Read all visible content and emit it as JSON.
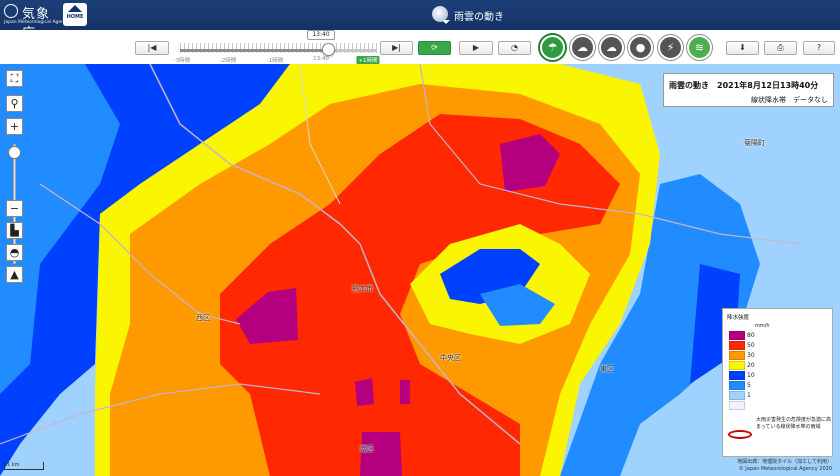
{
  "header": {
    "agency_name_jp": "気象庁",
    "agency_name_en": "Japan Meteorological Agency",
    "home_label": "HOME",
    "page_title": "雨雲の動き"
  },
  "timeline": {
    "current_time": "13:40",
    "ticks": [
      "-3時間",
      "-2時間",
      "-1時間",
      "13:40",
      "+1時間"
    ],
    "position_fraction": 0.75
  },
  "toolbar": {
    "left_buttons": [
      "step-back",
      "step-forward",
      "refresh",
      "play",
      "speed"
    ],
    "mode_buttons": [
      "rain-cloud-active",
      "thunder-cloud",
      "cloud-rain",
      "rain-drop",
      "lightning",
      "linear-rain-band"
    ],
    "right_buttons": [
      "download",
      "print",
      "help"
    ]
  },
  "info_box": {
    "title": "雨雲の動き　2021年8月12日13時40分",
    "subtitle": "線状降水帯　データなし"
  },
  "legend": {
    "title": "降水強度",
    "unit": "mm/h",
    "levels": [
      {
        "label": "80",
        "color": "#b4007e"
      },
      {
        "label": "50",
        "color": "#ff2800"
      },
      {
        "label": "30",
        "color": "#ff9900"
      },
      {
        "label": "20",
        "color": "#faf500"
      },
      {
        "label": "10",
        "color": "#0041ff"
      },
      {
        "label": "5",
        "color": "#218cff"
      },
      {
        "label": "1",
        "color": "#a0d2ff"
      },
      {
        "label": "",
        "color": "#f2f2ff"
      }
    ],
    "band_note": "大雨災害発生の危険度が急激に高まっている線状降水帯の雨域"
  },
  "map": {
    "place_labels": [
      "熊本市",
      "中央区",
      "西区",
      "東区",
      "南区",
      "菊陽町"
    ],
    "scale_label": "1 km",
    "attribution_line1": "地図出典：地理院タイル（加工して利用）",
    "attribution_line2": "© Japan Meteorological Agency 2020"
  }
}
